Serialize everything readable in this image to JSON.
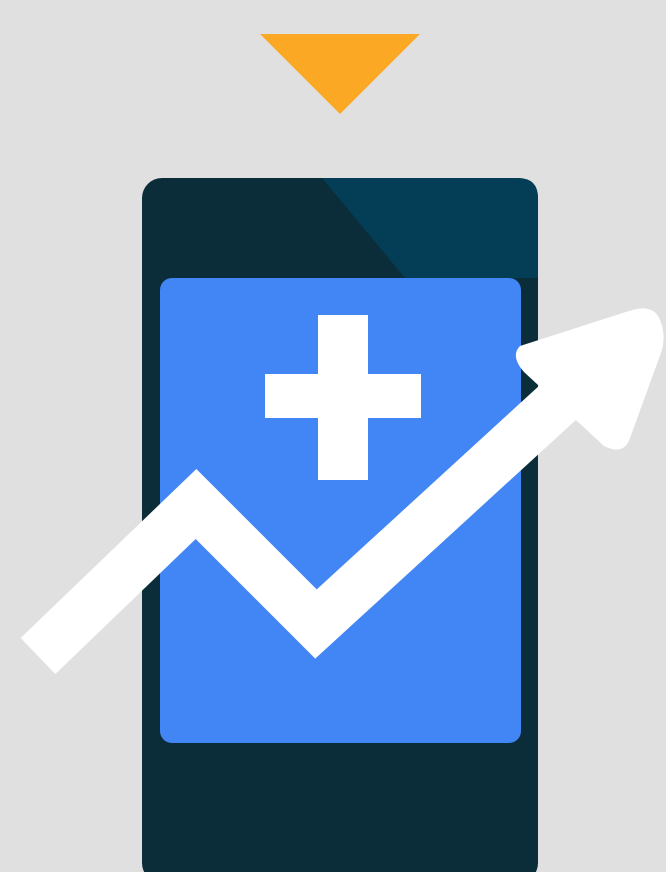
{
  "colors": {
    "background": "#e0e0e0",
    "pointer": "#fba924",
    "phone_body": "#0b2d3a",
    "phone_highlight": "#033e56",
    "screen": "#4285f4",
    "cross": "#ffffff",
    "trend_arrow": "#ffffff"
  },
  "icons": {
    "pointer": "triangle-down-icon",
    "device": "smartphone-icon",
    "symbol": "medical-cross-icon",
    "trend": "trend-up-arrow-icon"
  }
}
